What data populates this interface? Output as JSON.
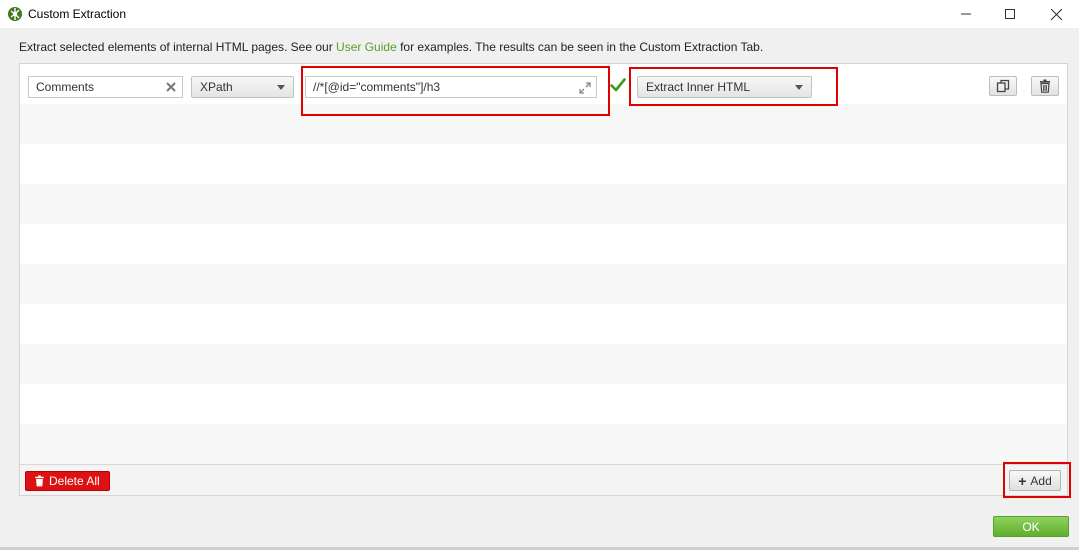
{
  "window": {
    "title": "Custom Extraction",
    "controls": {
      "minimize": "minimize-icon",
      "maximize": "maximize-icon",
      "close": "close-icon"
    }
  },
  "intro": {
    "before": "Extract selected elements of internal HTML pages. See our ",
    "link": "User Guide",
    "after": " for examples. The results can be seen in the Custom Extraction Tab."
  },
  "extractor": {
    "name": "Comments",
    "type": "XPath",
    "expression": "//*[@id=\"comments\"]/h3",
    "valid": true,
    "extract_mode": "Extract Inner HTML"
  },
  "footer": {
    "delete_all_label": "Delete All",
    "add_label": "Add"
  },
  "ok_label": "OK",
  "colors": {
    "accent": "#5aa02c",
    "danger": "#dd1111",
    "highlight": "#e00000",
    "ok": "#6cbf3a"
  }
}
